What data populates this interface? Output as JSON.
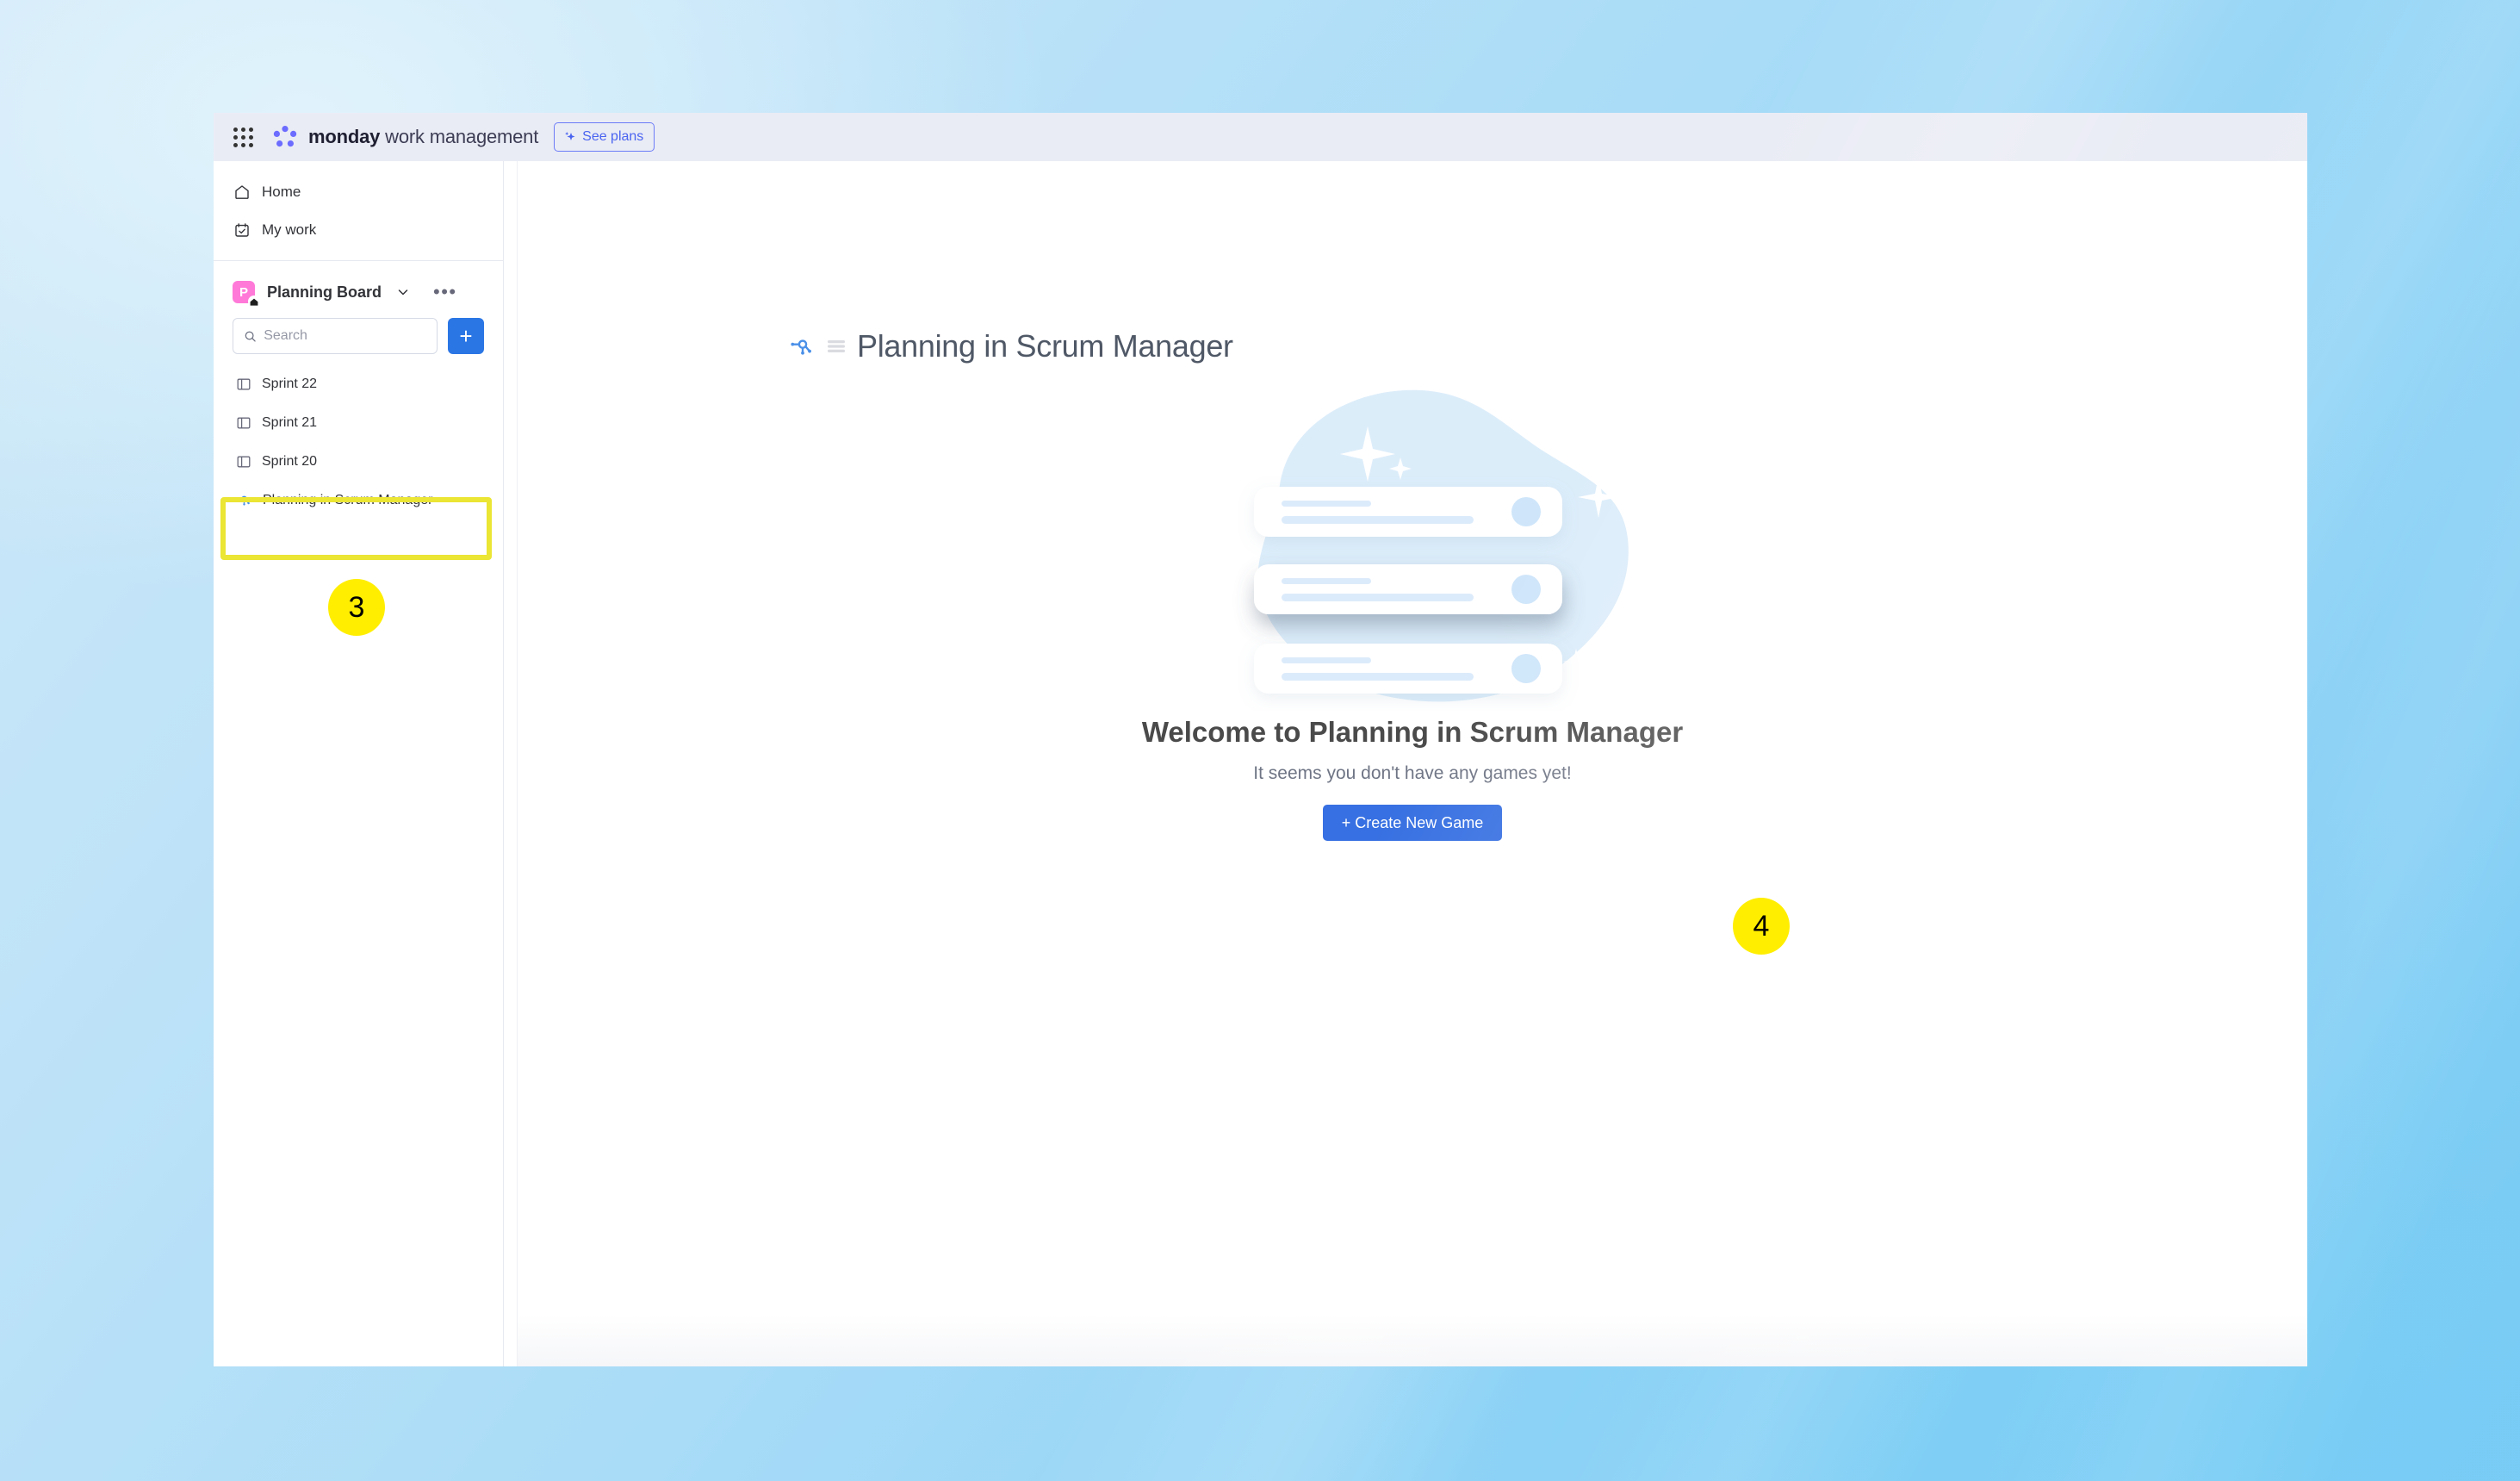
{
  "topbar": {
    "apps_icon": "waffle-grid-icon",
    "logo_icon": "monday-logo-icon",
    "brand_bold": "monday",
    "brand_light": "work management",
    "see_plans_label": "See plans",
    "see_plans_icon": "sparkle-icon"
  },
  "sidebar": {
    "nav": [
      {
        "icon": "home-icon",
        "label": "Home"
      },
      {
        "icon": "my-work-calendar-icon",
        "label": "My work"
      }
    ],
    "workspace": {
      "avatar_letter": "P",
      "avatar_color": "#ff79d8",
      "badge_icon": "home-badge-icon",
      "name": "Planning Board",
      "caret_icon": "chevron-down-icon",
      "more_icon": "more-options-icon",
      "more_glyph": "•••"
    },
    "search": {
      "icon": "search-icon",
      "placeholder": "Search",
      "value": ""
    },
    "add_button": {
      "icon": "plus-icon",
      "glyph": "+",
      "color": "#2b76e5"
    },
    "boards": [
      {
        "icon": "board-icon",
        "label": "Sprint 22",
        "active": false
      },
      {
        "icon": "board-icon",
        "label": "Sprint 21",
        "active": false
      },
      {
        "icon": "board-icon",
        "label": "Sprint 20",
        "active": false
      },
      {
        "icon": "scrum-manager-app-icon",
        "label": "Planning in Scrum Manager",
        "active": true
      }
    ]
  },
  "main": {
    "page_icon": "scrum-manager-app-icon",
    "page_menu_icon": "hamburger-menu-icon",
    "page_title": "Planning in Scrum Manager",
    "empty_state": {
      "illustration": "empty-cards-illustration",
      "title": "Welcome to Planning in Scrum Manager",
      "subtitle": "It seems you don't have any games yet!",
      "button_label": "+ Create New Game",
      "button_color": "#3770e2"
    }
  },
  "annotations": {
    "highlight_color": "#ebe534",
    "marker_color": "#ffee00",
    "markers": [
      {
        "id": "marker-3",
        "label": "3"
      },
      {
        "id": "marker-4",
        "label": "4"
      }
    ]
  }
}
